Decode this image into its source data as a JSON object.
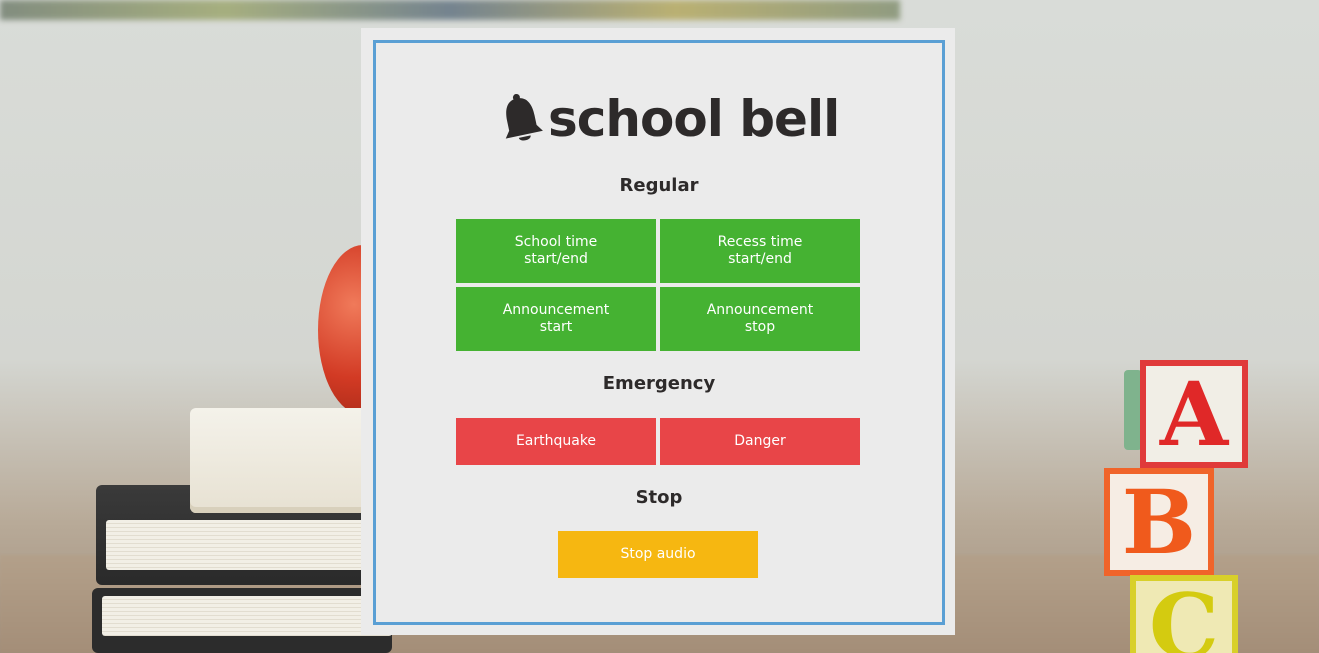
{
  "app": {
    "logo_text": "school bell",
    "logo_icon": "bell-icon"
  },
  "sections": {
    "regular": {
      "title": "Regular",
      "buttons": [
        {
          "line1": "School time",
          "line2": "start/end"
        },
        {
          "line1": "Recess time",
          "line2": "start/end"
        },
        {
          "line1": "Announcement",
          "line2": "start"
        },
        {
          "line1": "Announcement",
          "line2": "stop"
        }
      ]
    },
    "emergency": {
      "title": "Emergency",
      "buttons": [
        {
          "label": "Earthquake"
        },
        {
          "label": "Danger"
        }
      ]
    },
    "stop": {
      "title": "Stop",
      "button": {
        "label": "Stop audio"
      }
    }
  },
  "colors": {
    "regular_button": "#45b232",
    "emergency_button": "#e84548",
    "stop_button": "#f6b711",
    "card_border": "#5a9fd4",
    "card_background": "#ebebeb",
    "text_dark": "#2d2a2a"
  }
}
